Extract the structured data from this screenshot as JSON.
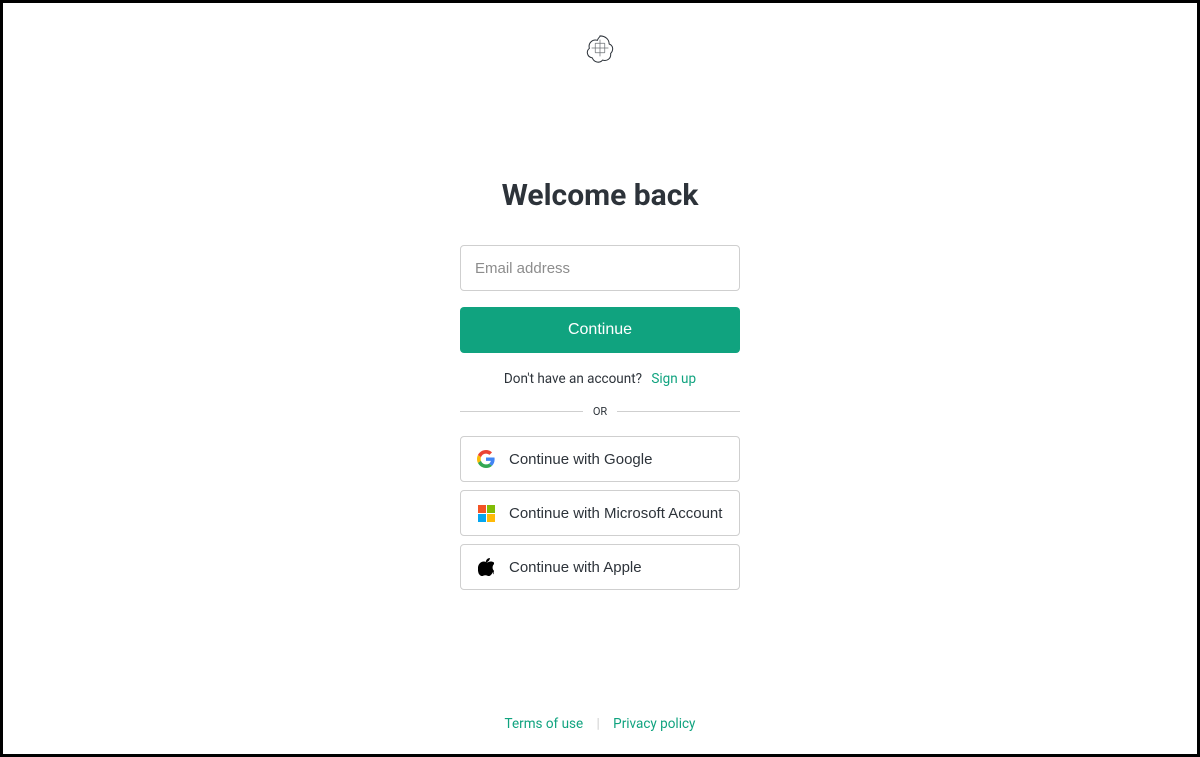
{
  "title": "Welcome back",
  "email_placeholder": "Email address",
  "continue_label": "Continue",
  "signup_prompt": "Don't have an account?",
  "signup_link": "Sign up",
  "or_label": "OR",
  "social": {
    "google": "Continue with Google",
    "microsoft": "Continue with Microsoft Account",
    "apple": "Continue with Apple"
  },
  "footer": {
    "terms": "Terms of use",
    "privacy": "Privacy policy"
  },
  "colors": {
    "accent": "#10a37f"
  }
}
